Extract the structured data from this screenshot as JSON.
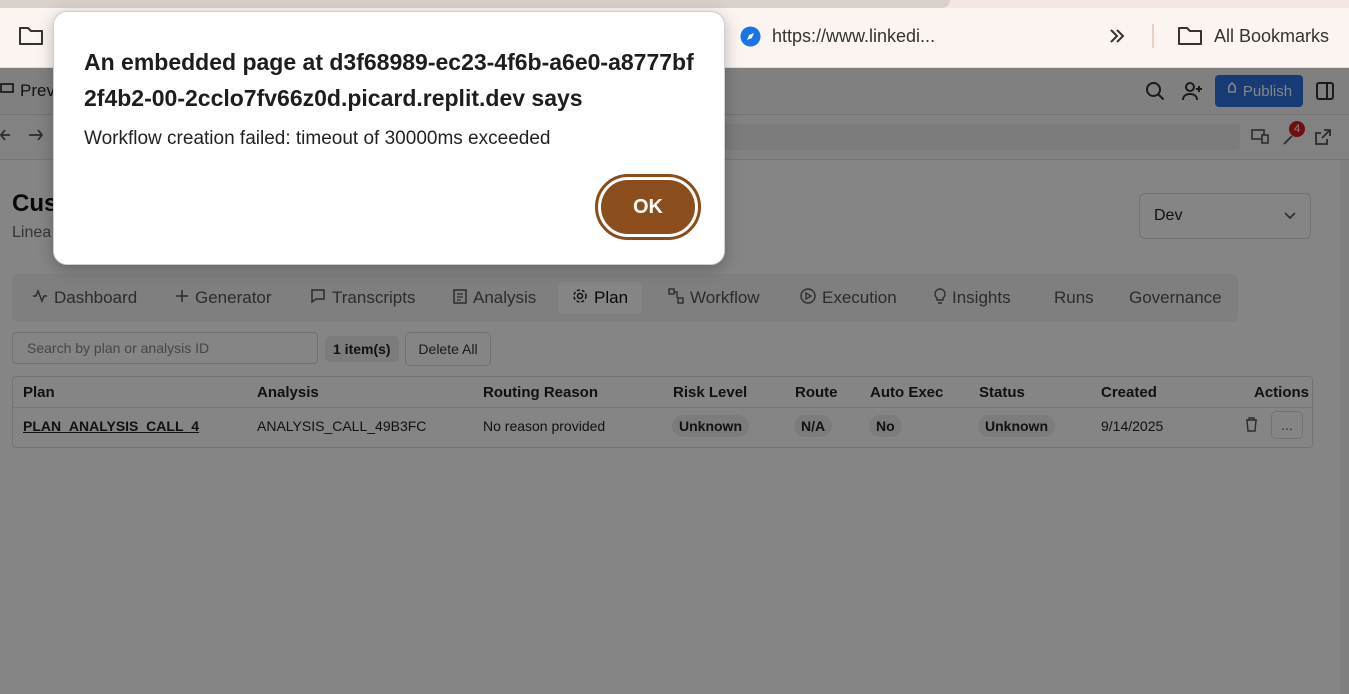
{
  "bookmarks": {
    "url_text": "https://www.linkedi...",
    "all_bookmarks": "All Bookmarks"
  },
  "replit": {
    "preview_label": "Prev",
    "publish_label": "Publish",
    "notification_count": "4"
  },
  "page": {
    "title": "Cus",
    "subtitle": "Linea",
    "env_value": "Dev",
    "tabs": [
      {
        "label": "Dashboard",
        "icon": "activity-icon"
      },
      {
        "label": "Generator",
        "icon": "plus-icon"
      },
      {
        "label": "Transcripts",
        "icon": "message-icon"
      },
      {
        "label": "Analysis",
        "icon": "clipboard-icon"
      },
      {
        "label": "Plan",
        "icon": "gear-icon",
        "active": true
      },
      {
        "label": "Workflow",
        "icon": "workflow-icon"
      },
      {
        "label": "Execution",
        "icon": "play-circle-icon"
      },
      {
        "label": "Insights",
        "icon": "lightbulb-icon"
      },
      {
        "label": "Runs",
        "icon": ""
      },
      {
        "label": "Governance",
        "icon": ""
      }
    ],
    "search_placeholder": "Search by plan or analysis ID",
    "item_count": "1 item(s)",
    "delete_all": "Delete All",
    "table": {
      "headers": [
        "Plan",
        "Analysis",
        "Routing Reason",
        "Risk Level",
        "Route",
        "Auto Exec",
        "Status",
        "Created",
        "Actions"
      ],
      "rows": [
        {
          "plan": "PLAN_ANALYSIS_CALL_4",
          "analysis": "ANALYSIS_CALL_49B3FC",
          "routing_reason": "No reason provided",
          "risk_level": "Unknown",
          "route": "N/A",
          "auto_exec": "No",
          "status": "Unknown",
          "created": "9/14/2025",
          "more": "..."
        }
      ]
    }
  },
  "dialog": {
    "title": "An embedded page at d3f68989-ec23-4f6b-a6e0-a8777bf2f4b2-00-2cclo7fv66z0d.picard.replit.dev says",
    "message": "Workflow creation failed: timeout of 30000ms exceeded",
    "ok_label": "OK"
  },
  "colors": {
    "ok_button": "#8b4d1c",
    "publish": "#2f6fe0",
    "badge": "#d5201f"
  }
}
